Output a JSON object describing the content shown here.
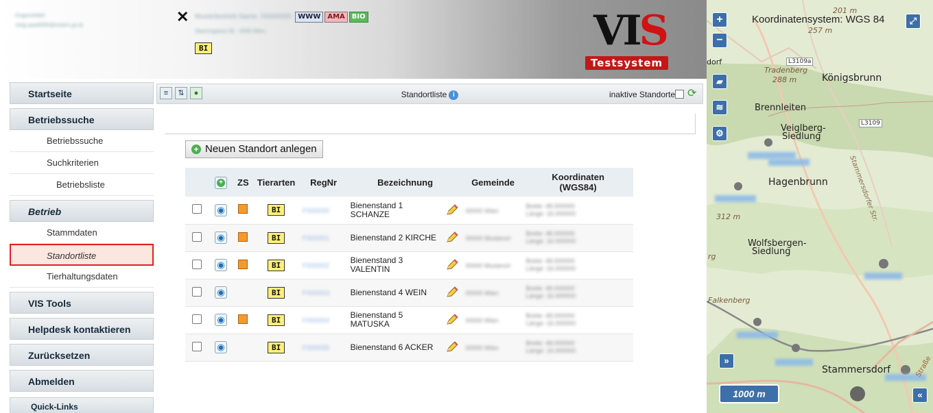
{
  "header": {
    "user_line1": "Angemeldet:",
    "user_line2": "vistg.apa0000@extern.gv.at",
    "betrieb_name": "Musterbetrieb Name, 00000000",
    "betrieb_address": "Stammgasse 00 · 0000 Wien",
    "badges": {
      "www": "WWW",
      "ama": "AMA",
      "bio": "BIO"
    },
    "bi": "BI",
    "logo_text": "VIS",
    "logo_sub": "Testsystem"
  },
  "sidebar": {
    "startseite": "Startseite",
    "betriebssuche_group": "Betriebssuche",
    "betriebssuche": "Betriebssuche",
    "suchkriterien": "Suchkriterien",
    "betriebsliste": "Betriebsliste",
    "betrieb_group": "Betrieb",
    "stammdaten": "Stammdaten",
    "standortliste": "Standortliste",
    "tierhaltungsdaten": "Tierhaltungsdaten",
    "vis_tools": "VIS Tools",
    "helpdesk": "Helpdesk kontaktieren",
    "zuruecksetzen": "Zurücksetzen",
    "abmelden": "Abmelden",
    "quick_links": "Quick-Links"
  },
  "toolbar": {
    "title": "Standortliste",
    "inaktive": "inaktive Standorte"
  },
  "new_button": "Neuen Standort anlegen",
  "table": {
    "headers": {
      "zs": "ZS",
      "tierarten": "Tierarten",
      "regnr": "RegNr",
      "bezeichnung": "Bezeichnung",
      "gemeinde": "Gemeinde",
      "koordinaten_1": "Koordinaten",
      "koordinaten_2": "(WGS84)"
    },
    "rows": [
      {
        "regnr": "F000000",
        "bez": "Bienenstand 1 SCHANZE",
        "gemeinde": "00000 Wien",
        "breite": "Breite: 48.000000",
        "laenge": "Länge: 16.000000",
        "zs": true,
        "tier": "BI"
      },
      {
        "regnr": "F000001",
        "bez": "Bienenstand 2 KIRCHE",
        "gemeinde": "00000 Musterort",
        "breite": "Breite: 48.000000",
        "laenge": "Länge: 16.000000",
        "zs": true,
        "tier": "BI"
      },
      {
        "regnr": "F000002",
        "bez": "Bienenstand 3 VALENTIN",
        "gemeinde": "00000 Musterort",
        "breite": "Breite: 48.000000",
        "laenge": "Länge: 16.000000",
        "zs": true,
        "tier": "BI"
      },
      {
        "regnr": "F000003",
        "bez": "Bienenstand 4 WEIN",
        "gemeinde": "00000 Wien",
        "breite": "Breite: 48.000000",
        "laenge": "Länge: 16.000000",
        "zs": false,
        "tier": "BI"
      },
      {
        "regnr": "F000004",
        "bez": "Bienenstand 5 MATUSKA",
        "gemeinde": "00000 Wien",
        "breite": "Breite: 48.000000",
        "laenge": "Länge: 16.000000",
        "zs": true,
        "tier": "BI"
      },
      {
        "regnr": "F000005",
        "bez": "Bienenstand 6 ACKER",
        "gemeinde": "00000 Wien",
        "breite": "Breite: 48.000000",
        "laenge": "Länge: 16.000000",
        "zs": false,
        "tier": "BI"
      }
    ]
  },
  "map": {
    "title": "Koordinatensystem: WGS 84",
    "scale": "1000 m",
    "labels": {
      "koenigsbrunn": "Königsbrunn",
      "brennleiten": "Brennleiten",
      "veiglberg": "Veiglberg-",
      "siedlung": "Siedlung",
      "hagenbrunn": "Hagenbrunn",
      "wolfsbergen": "Wolfsbergen-",
      "wolf_siedlung": "Siedlung",
      "falkenberg": "Falkenberg",
      "stammersdorf": "Stammersdorf",
      "tradenberg": "Tradenberg",
      "h288": "288 m",
      "h312": "312 m",
      "h201": "201 m",
      "h257": "257 m",
      "l3109a": "L3109a",
      "l3109": "L3109",
      "strasse": "Straße",
      "stammersdorfer": "Stammersdorfer Str.",
      "dorf": "dorf",
      "rg": "rg"
    }
  }
}
